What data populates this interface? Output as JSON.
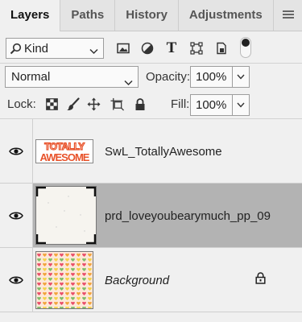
{
  "tabs": [
    {
      "label": "Layers",
      "active": true
    },
    {
      "label": "Paths",
      "active": false
    },
    {
      "label": "History",
      "active": false
    },
    {
      "label": "Adjustments",
      "active": false
    }
  ],
  "filter": {
    "kind_value": "Kind",
    "icons": [
      "image-filter-icon",
      "adjustment-filter-icon",
      "type-filter-icon",
      "shape-filter-icon",
      "smart-object-filter-icon"
    ]
  },
  "blend": {
    "mode": "Normal",
    "opacity_label": "Opacity:",
    "opacity_value": "100%"
  },
  "lock": {
    "label": "Lock:",
    "icons": [
      "lock-transparent-pixels-icon",
      "lock-image-pixels-icon",
      "lock-position-icon",
      "lock-artboard-icon",
      "lock-all-icon"
    ],
    "fill_label": "Fill:",
    "fill_value": "100%"
  },
  "layers": [
    {
      "name": "SwL_TotallyAwesome",
      "visible": true,
      "selected": false,
      "italic": false,
      "thumb_text_top": "TOTALLY",
      "thumb_text_bottom": "AWESOME"
    },
    {
      "name": "prd_loveyoubearymuch_pp_09",
      "visible": true,
      "selected": true,
      "italic": false
    },
    {
      "name": "Background",
      "visible": true,
      "selected": false,
      "italic": true,
      "locked": true
    }
  ],
  "colors": {
    "selected_row": "#b3b3b3",
    "panel_bg": "#f0f0f0",
    "totally_orange": "#e8522a"
  }
}
